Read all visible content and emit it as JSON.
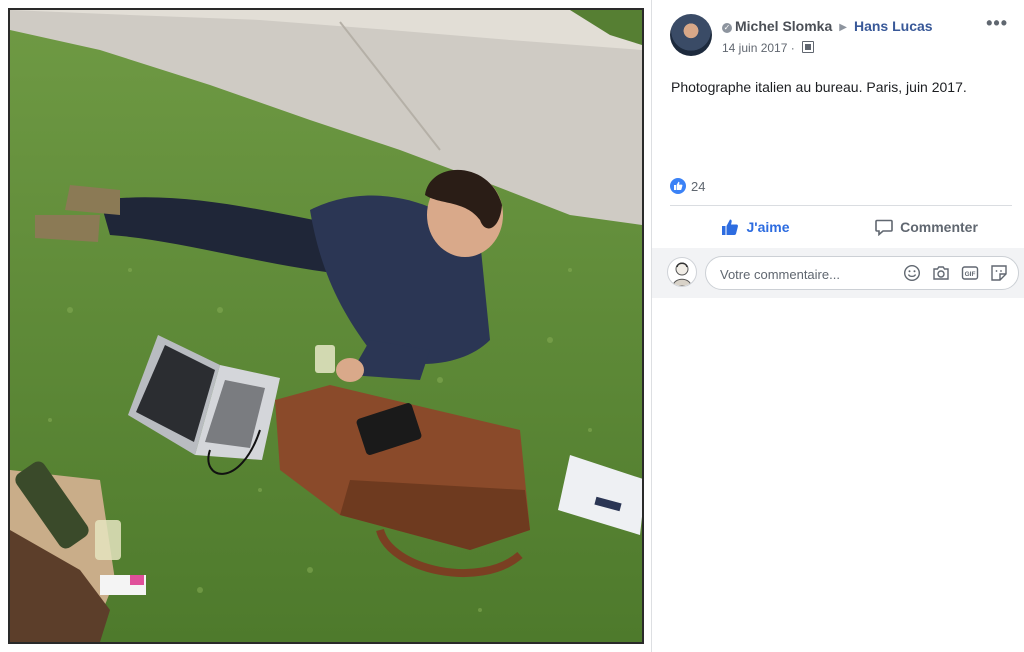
{
  "post": {
    "author": "Michel Slomka",
    "page": "Hans Lucas",
    "date": "14 juin 2017",
    "separator": "·",
    "more": "•••",
    "caption": "Photographe italien au bureau. Paris, juin 2017.",
    "reaction_count": "24"
  },
  "actions": {
    "like_label": "J'aime",
    "comment_label": "Commenter"
  },
  "comment": {
    "placeholder": "Votre commentaire...",
    "gif_label": "GIF"
  },
  "colors": {
    "link": "#385898",
    "like_blue": "#2d6ce0",
    "comment_bg": "#f2f3f5"
  },
  "icons": [
    "verified-icon",
    "chevron-right-icon",
    "globe-icon",
    "more-icon",
    "like-icon",
    "thumbs-up-icon",
    "comment-icon",
    "smiley-icon",
    "camera-icon",
    "gif-icon",
    "sticker-icon"
  ]
}
